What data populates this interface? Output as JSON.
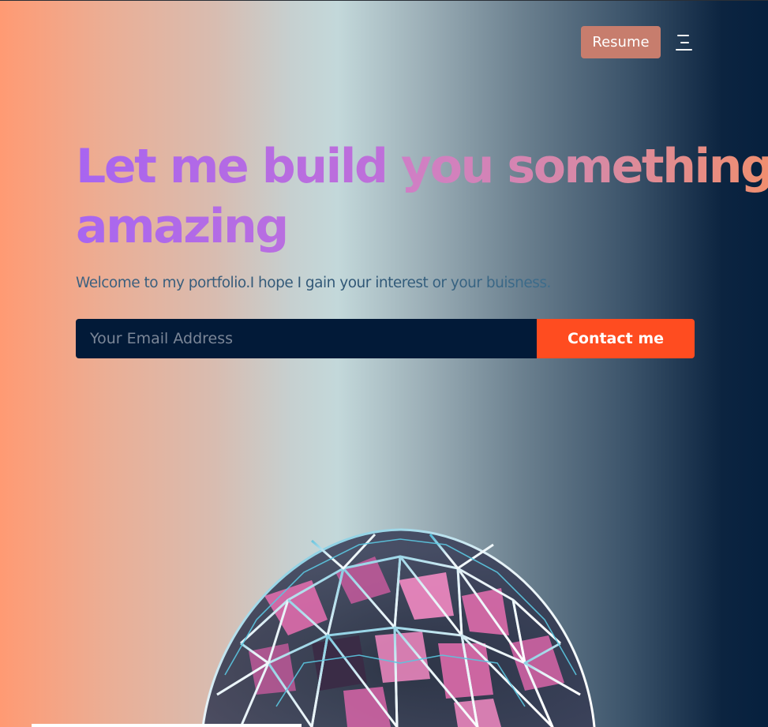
{
  "header": {
    "resume_label": "Resume",
    "menu_icon": "hamburger-menu-icon"
  },
  "hero": {
    "title_line1_part1": "Let me build ",
    "title_line1_part2": "you something",
    "title_line2": "amazing",
    "subtitle": "Welcome to my portfolio.I hope I gain your interest or your buisness."
  },
  "contact": {
    "email_placeholder": "Your Email Address",
    "email_value": "",
    "button_label": "Contact me"
  },
  "graphic": {
    "icon": "geodesic-sphere-graphic"
  },
  "colors": {
    "accent_orange": "#ff4c20",
    "resume_button": "#c77d6d",
    "input_background": "#021a38",
    "title_purple": "#a865f0",
    "title_orange": "#f08e6e",
    "gradient_left": "#ff9a73",
    "gradient_right": "#06203e"
  }
}
